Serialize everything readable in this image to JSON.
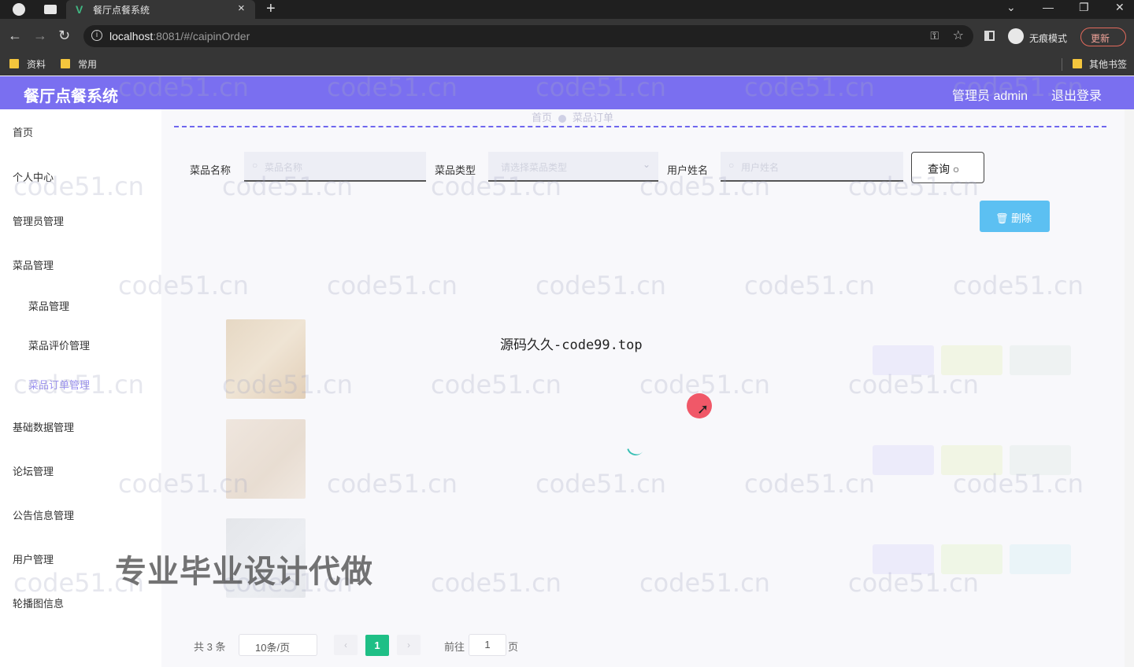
{
  "browser": {
    "tab_title": "餐厅点餐系统",
    "url_host": "localhost",
    "url_rest": ":8081/#/caipinOrder",
    "incognito_label": "无痕模式",
    "update_label": "更新",
    "bookmarks": [
      "资料",
      "常用"
    ],
    "other_bookmarks": "其他书签"
  },
  "header": {
    "title": "餐厅点餐系统",
    "user": "管理员 admin",
    "logout": "退出登录",
    "color": "#7a6ff0"
  },
  "sidebar": {
    "items": [
      "首页",
      "个人中心",
      "管理员管理",
      "菜品管理",
      "菜品管理",
      "菜品评价管理",
      "菜品订单管理",
      "基础数据管理",
      "论坛管理",
      "公告信息管理",
      "用户管理",
      "轮播图信息"
    ],
    "active": "菜品订单管理"
  },
  "breadcrumb": {
    "home": "首页",
    "current": "菜品订单"
  },
  "search": {
    "dish_name_label": "菜品名称",
    "dish_name_placeholder": "菜品名称",
    "dish_type_label": "菜品类型",
    "dish_type_placeholder": "请选择菜品类型",
    "user_name_label": "用户姓名",
    "user_name_placeholder": "用户姓名",
    "query_button": "查询",
    "delete_button": "删除"
  },
  "overlay": {
    "text": "源码久久-code99.top",
    "promo": "专业毕业设计代做",
    "watermark": "code51.cn"
  },
  "pagination": {
    "total": "共 3 条",
    "page_size": "10条/页",
    "current_page": "1",
    "goto_label": "前往",
    "goto_value": "1",
    "page_suffix": "页"
  },
  "colors": {
    "accent": "#7a6ff0",
    "delete": "#5cc0f2",
    "page_active": "#1fbf86"
  }
}
